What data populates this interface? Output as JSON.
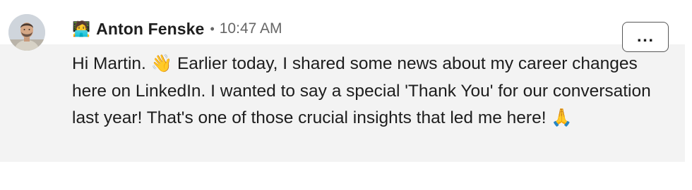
{
  "message": {
    "sender": {
      "emoji": "🧑‍💻",
      "name": "Anton Fenske",
      "avatar_icon": "profile-photo"
    },
    "separator": "•",
    "timestamp": "10:47 AM",
    "text": "Hi Martin. 👋 Earlier today, I shared some news about my career changes here on LinkedIn. I wanted to say a special 'Thank You' for our conversation last year! That's one of those crucial insights that led me here! 🙏",
    "more_button_label": "...",
    "more_button_icon": "more-options-icon"
  },
  "colors": {
    "message_background": "#f3f3f3",
    "timestamp": "#666666",
    "text": "#1d1d1d"
  }
}
